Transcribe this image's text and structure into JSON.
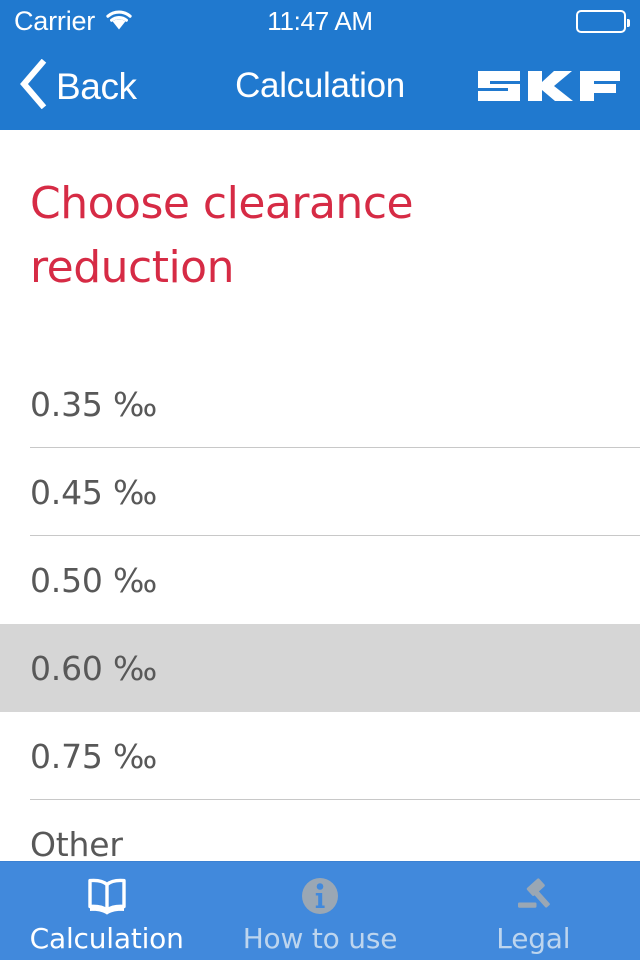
{
  "status_bar": {
    "carrier": "Carrier",
    "wifi_icon": "wifi-icon",
    "time": "11:47 AM",
    "battery_icon": "battery-icon",
    "battery_level_percent": 0
  },
  "nav_bar": {
    "back_icon": "chevron-left-icon",
    "back_label": "Back",
    "title": "Calculation",
    "logo_text": "SKF"
  },
  "main": {
    "page_title": "Choose clearance reduction",
    "options": [
      {
        "label": "0.35 ‰",
        "selected": false
      },
      {
        "label": "0.45 ‰",
        "selected": false
      },
      {
        "label": "0.50 ‰",
        "selected": false
      },
      {
        "label": "0.60 ‰",
        "selected": true
      },
      {
        "label": "0.75 ‰",
        "selected": false
      },
      {
        "label": "Other",
        "selected": false
      }
    ]
  },
  "tab_bar": {
    "tabs": [
      {
        "label": "Calculation",
        "icon": "book-icon",
        "active": true
      },
      {
        "label": "How to use",
        "icon": "info-circle-icon",
        "active": false
      },
      {
        "label": "Legal",
        "icon": "gavel-icon",
        "active": false
      }
    ]
  },
  "colors": {
    "header_blue": "#2079CF",
    "tabbar_blue": "#4189DC",
    "title_red": "#D62B45",
    "row_selected_gray": "#D6D6D6",
    "row_text_gray": "#585858",
    "separator_gray": "#C8C8C8",
    "inactive_tab": "#BDD5EE",
    "inactive_icon": "#9AA7B4"
  }
}
